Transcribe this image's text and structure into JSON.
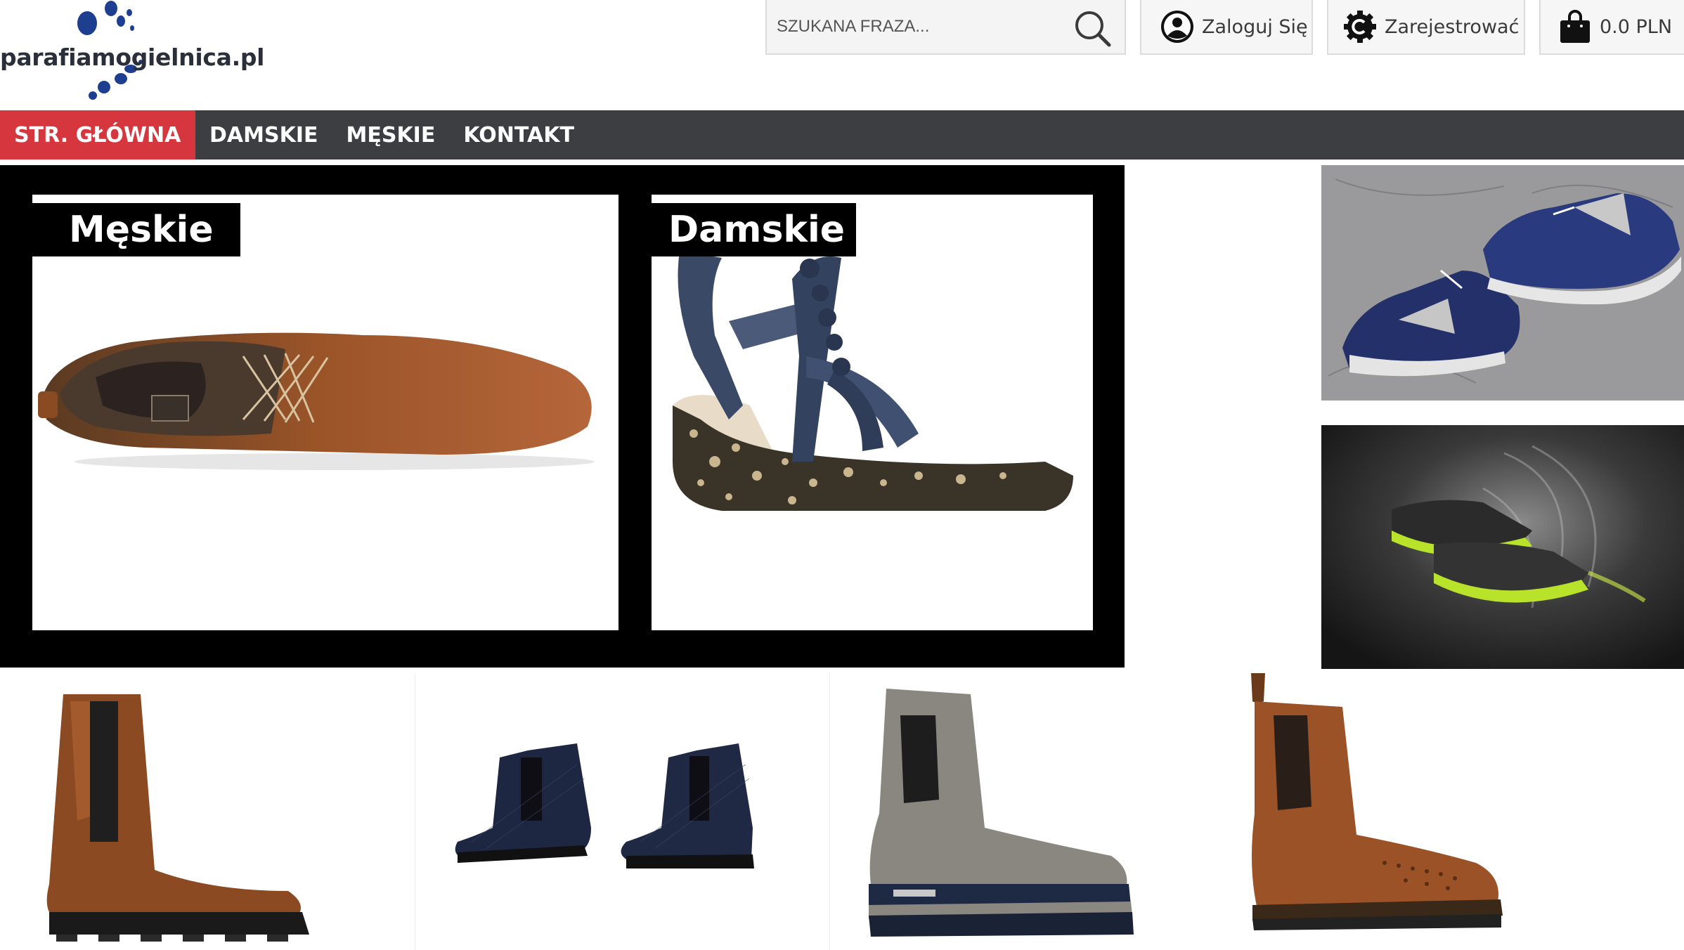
{
  "site": {
    "logo_text": "parafiamogielnica.pl",
    "brand_color": "#1e3f8f"
  },
  "header": {
    "search": {
      "placeholder": "SZUKANA FRAZA...",
      "value": "",
      "icon": "search-icon"
    },
    "login": {
      "label": "Zaloguj Się",
      "icon": "user-icon"
    },
    "register": {
      "label": "Zarejestrować",
      "icon": "register-gear-icon"
    },
    "cart": {
      "label": "0.0 PLN",
      "icon": "shopping-bag-icon"
    }
  },
  "nav": {
    "items": [
      {
        "label": "STR. GŁÓWNA",
        "active": true
      },
      {
        "label": "DAMSKIE",
        "active": false
      },
      {
        "label": "MĘSKIE",
        "active": false
      },
      {
        "label": "KONTAKT",
        "active": false
      }
    ],
    "active_color": "#d6363d",
    "bar_color": "#3d3e42"
  },
  "hero": {
    "left": {
      "label": "Męskie",
      "image": "brown-leather-lace-up-boot"
    },
    "right": {
      "label": "Damskie",
      "image": "navy-wedge-sandal"
    }
  },
  "side_banners": [
    {
      "image": "blue-running-sneakers"
    },
    {
      "image": "green-sport-shoes-smoke"
    }
  ],
  "products": [
    {
      "image": "brown-chelsea-boot-tommy"
    },
    {
      "image": "navy-snake-ankle-boots"
    },
    {
      "image": "grey-suede-chelsea-boot"
    },
    {
      "image": "brown-brogue-chelsea-boot"
    }
  ]
}
